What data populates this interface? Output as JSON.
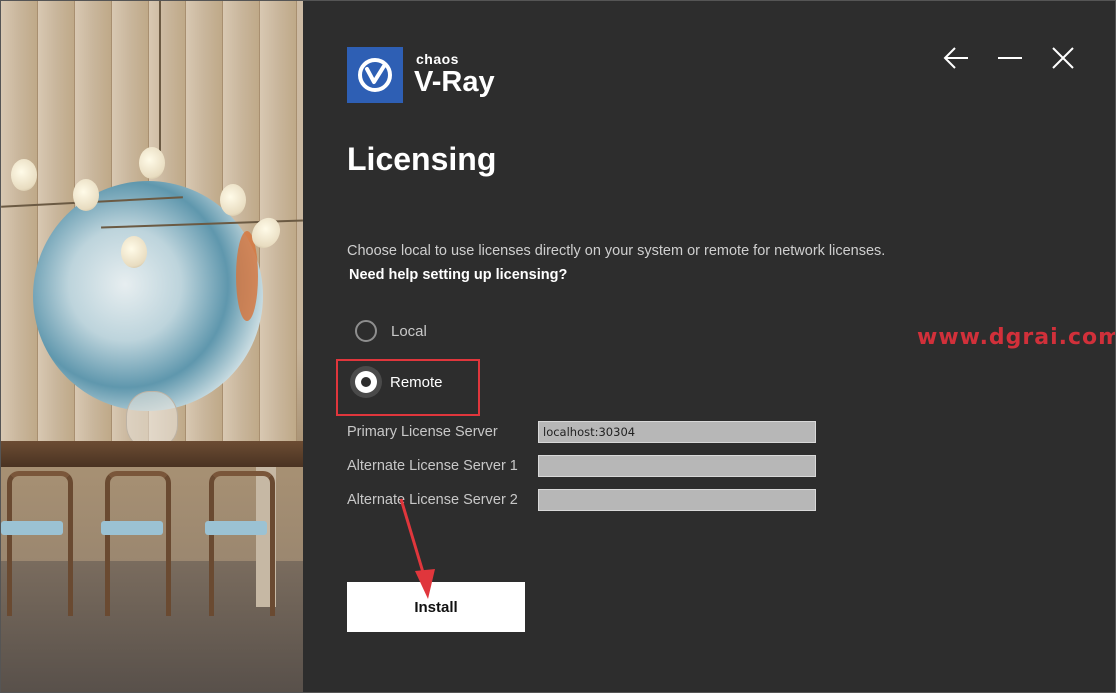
{
  "brand": {
    "company": "chaos",
    "product": "V-Ray",
    "logo_color": "#2e5fb4"
  },
  "window_controls": {
    "back_icon": "arrow-left-icon",
    "minimize_icon": "minimize-icon",
    "close_icon": "close-icon"
  },
  "page": {
    "title": "Licensing",
    "description": "Choose local to use licenses directly on your system or remote for network licenses.",
    "help_link": "Need help setting up licensing?"
  },
  "license_mode": {
    "options": [
      {
        "label": "Local",
        "selected": false
      },
      {
        "label": "Remote",
        "selected": true
      }
    ]
  },
  "servers": {
    "primary": {
      "label": "Primary License Server",
      "value": "localhost:30304"
    },
    "alternate1": {
      "label": "Alternate License Server 1",
      "value": ""
    },
    "alternate2": {
      "label": "Alternate License Server 2",
      "value": ""
    }
  },
  "actions": {
    "install_label": "Install"
  },
  "watermark": "www.dgrai.com",
  "colors": {
    "panel_bg": "#2d2d2d",
    "highlight": "#e0363c",
    "button_bg": "#ffffff"
  }
}
